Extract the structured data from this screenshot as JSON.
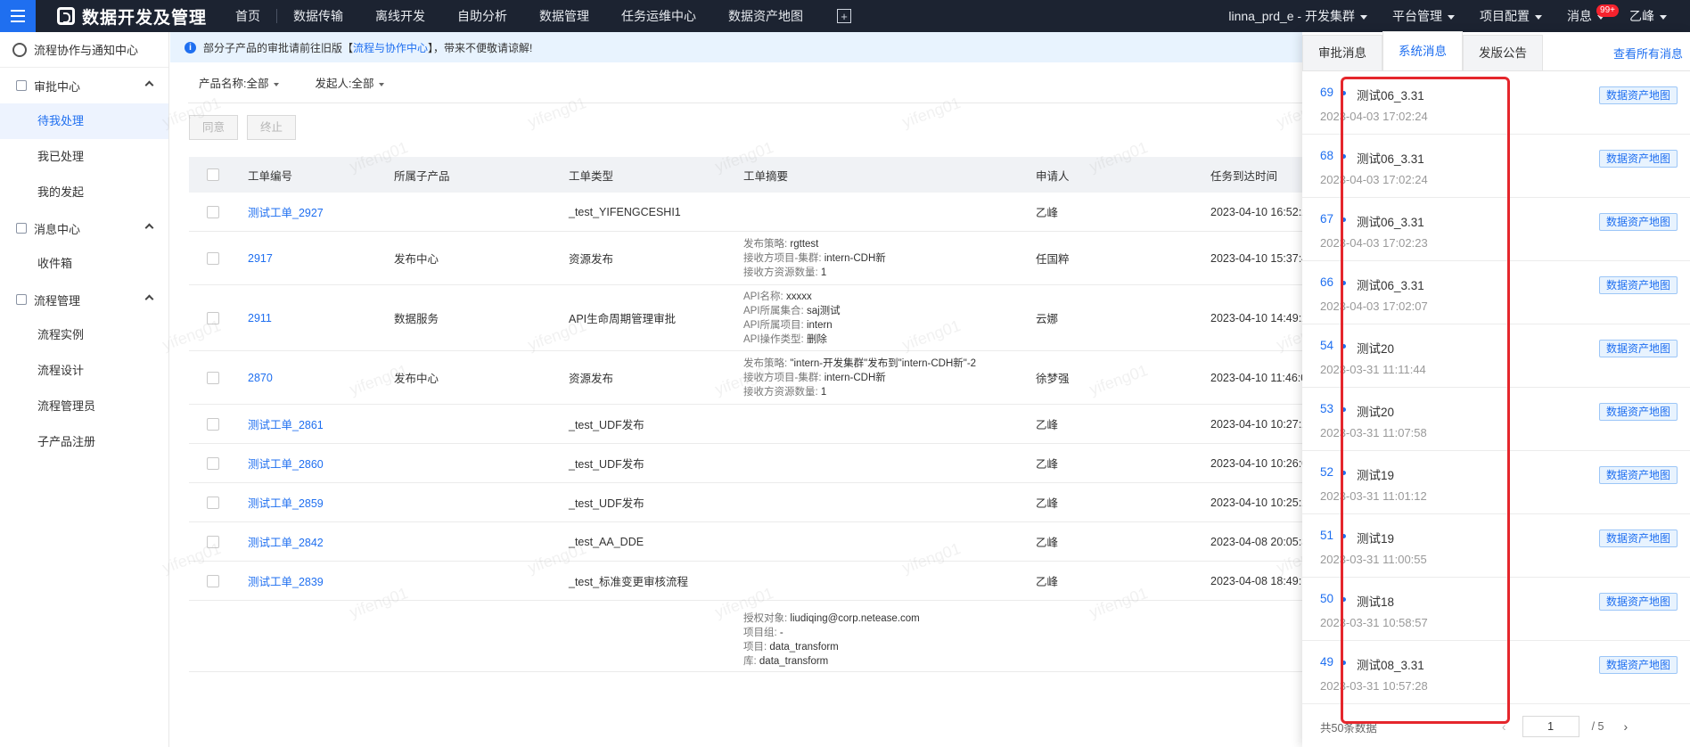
{
  "topbar": {
    "logo_text": "数据开发及管理",
    "nav": [
      "首页",
      "数据传输",
      "离线开发",
      "自助分析",
      "数据管理",
      "任务运维中心",
      "数据资产地图"
    ],
    "cluster": "linna_prd_e - 开发集群",
    "platform": "平台管理",
    "project": "项目配置",
    "messages": "消息",
    "badge": "99+",
    "user": "乙峰"
  },
  "sidebar": {
    "title": "流程协作与通知中心",
    "groups": [
      {
        "label": "审批中心",
        "items": [
          "待我处理",
          "我已处理",
          "我的发起"
        ]
      },
      {
        "label": "消息中心",
        "items": [
          "收件箱"
        ]
      },
      {
        "label": "流程管理",
        "items": [
          "流程实例",
          "流程设计",
          "流程管理员",
          "子产品注册"
        ]
      }
    ]
  },
  "notice": {
    "prefix": "部分子产品的审批请前往旧版【",
    "link": "流程与协作中心",
    "suffix": "】，带来不便敬请谅解!"
  },
  "filters": {
    "product": "产品名称:全部",
    "initiator": "发起人:全部"
  },
  "actions": {
    "approve": "同意",
    "terminate": "终止"
  },
  "table": {
    "headers": [
      "工单编号",
      "所属子产品",
      "工单类型",
      "工单摘要",
      "申请人",
      "任务到达时间"
    ],
    "rows": [
      {
        "id": "测试工单_2927",
        "product": "",
        "type": "_test_YIFENGCESHI1",
        "summary": [],
        "applicant": "乙峰",
        "time": "2023-04-10 16:52:2"
      },
      {
        "id": "2917",
        "product": "发布中心",
        "type": "资源发布",
        "summary": [
          {
            "k": "发布策略:",
            "v": "rgttest"
          },
          {
            "k": "接收方项目-集群:",
            "v": "intern-CDH新"
          },
          {
            "k": "接收方资源数量:",
            "v": "1"
          }
        ],
        "applicant": "任国粹",
        "time": "2023-04-10 15:37:4"
      },
      {
        "id": "2911",
        "product": "数据服务",
        "type": "API生命周期管理审批",
        "summary": [
          {
            "k": "API名称:",
            "v": "xxxxx"
          },
          {
            "k": "API所属集合:",
            "v": "saj测试"
          },
          {
            "k": "API所属项目:",
            "v": "intern"
          },
          {
            "k": "API操作类型:",
            "v": "删除"
          }
        ],
        "applicant": "云娜",
        "time": "2023-04-10 14:49:2"
      },
      {
        "id": "2870",
        "product": "发布中心",
        "type": "资源发布",
        "summary": [
          {
            "k": "发布策略:",
            "v": "\"intern-开发集群\"发布到\"intern-CDH新\"-2"
          },
          {
            "k": "接收方项目-集群:",
            "v": "intern-CDH新"
          },
          {
            "k": "接收方资源数量:",
            "v": "1"
          }
        ],
        "applicant": "徐梦强",
        "time": "2023-04-10 11:46:0"
      },
      {
        "id": "测试工单_2861",
        "product": "",
        "type": "_test_UDF发布",
        "summary": [],
        "applicant": "乙峰",
        "time": "2023-04-10 10:27:2"
      },
      {
        "id": "测试工单_2860",
        "product": "",
        "type": "_test_UDF发布",
        "summary": [],
        "applicant": "乙峰",
        "time": "2023-04-10 10:26:0"
      },
      {
        "id": "测试工单_2859",
        "product": "",
        "type": "_test_UDF发布",
        "summary": [],
        "applicant": "乙峰",
        "time": "2023-04-10 10:25:2"
      },
      {
        "id": "测试工单_2842",
        "product": "",
        "type": "_test_AA_DDE",
        "summary": [],
        "applicant": "乙峰",
        "time": "2023-04-08 20:05:3"
      },
      {
        "id": "测试工单_2839",
        "product": "",
        "type": "_test_标准变更审核流程",
        "summary": [],
        "applicant": "乙峰",
        "time": "2023-04-08 18:49:1"
      },
      {
        "id": "",
        "product": "",
        "type": "",
        "summary": [
          {
            "k": "授权对象:",
            "v": "liudiqing@corp.netease.com"
          },
          {
            "k": "项目组:",
            "v": "-"
          },
          {
            "k": "项目:",
            "v": "data_transform"
          },
          {
            "k": "库:",
            "v": "data_transform"
          }
        ],
        "applicant": "",
        "time": ""
      }
    ]
  },
  "panel": {
    "tabs": [
      "审批消息",
      "系统消息",
      "发版公告"
    ],
    "active_tab": 1,
    "view_all": "查看所有消息",
    "items": [
      {
        "num": "69",
        "title": "测试06_3.31",
        "time": "2023-04-03 17:02:24",
        "tag": "数据资产地图"
      },
      {
        "num": "68",
        "title": "测试06_3.31",
        "time": "2023-04-03 17:02:24",
        "tag": "数据资产地图"
      },
      {
        "num": "67",
        "title": "测试06_3.31",
        "time": "2023-04-03 17:02:23",
        "tag": "数据资产地图"
      },
      {
        "num": "66",
        "title": "测试06_3.31",
        "time": "2023-04-03 17:02:07",
        "tag": "数据资产地图"
      },
      {
        "num": "54",
        "title": "测试20",
        "time": "2023-03-31 11:11:44",
        "tag": "数据资产地图"
      },
      {
        "num": "53",
        "title": "测试20",
        "time": "2023-03-31 11:07:58",
        "tag": "数据资产地图"
      },
      {
        "num": "52",
        "title": "测试19",
        "time": "2023-03-31 11:01:12",
        "tag": "数据资产地图"
      },
      {
        "num": "51",
        "title": "测试19",
        "time": "2023-03-31 11:00:55",
        "tag": "数据资产地图"
      },
      {
        "num": "50",
        "title": "测试18",
        "time": "2023-03-31 10:58:57",
        "tag": "数据资产地图"
      },
      {
        "num": "49",
        "title": "测试08_3.31",
        "time": "2023-03-31 10:57:28",
        "tag": "数据资产地图"
      }
    ],
    "footer": {
      "total": "共50条数据",
      "page": "1",
      "pages": "/ 5"
    }
  },
  "watermark": "yifeng01",
  "colors": {
    "brand": "#1f6ff0",
    "topbar": "#1c2331",
    "highlight": "#e5262c"
  }
}
